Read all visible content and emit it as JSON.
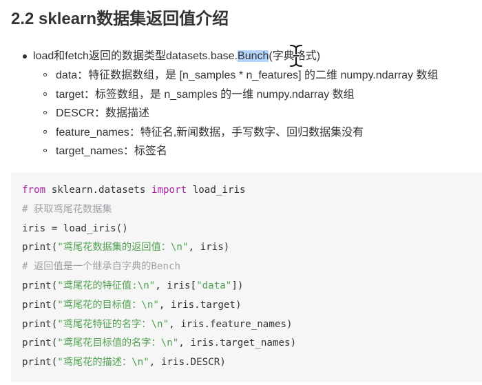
{
  "heading": "2.2 sklearn数据集返回值介绍",
  "bullet": {
    "prefix": "load和fetch返回的数据类型datasets.base.",
    "highlight": "Bunch",
    "suffix": "(字典格式)"
  },
  "sub_items": [
    "data：特征数据数组，是 [n_samples * n_features] 的二维 numpy.ndarray 数组",
    "target：标签数组，是 n_samples 的一维 numpy.ndarray 数组",
    "DESCR：数据描述",
    "feature_names：特征名,新闻数据，手写数字、回归数据集没有",
    "target_names：标签名"
  ],
  "code": {
    "line1": {
      "kw1": "from",
      "mid": " sklearn.datasets ",
      "kw2": "import",
      "rest": " load_iris"
    },
    "line2": "# 获取鸢尾花数据集",
    "line3": "iris = load_iris()",
    "line4": {
      "pre": "print(",
      "str": "\"鸢尾花数据集的返回值：\\n\"",
      "post": ", iris)"
    },
    "line5": "# 返回值是一个继承自字典的Bench",
    "line6": {
      "pre": "print(",
      "str": "\"鸢尾花的特征值:\\n\"",
      "mid": ", iris[",
      "str2": "\"data\"",
      "post": "])"
    },
    "line7": {
      "pre": "print(",
      "str": "\"鸢尾花的目标值：\\n\"",
      "post": ", iris.target)"
    },
    "line8": {
      "pre": "print(",
      "str": "\"鸢尾花特征的名字：\\n\"",
      "post": ", iris.feature_names)"
    },
    "line9": {
      "pre": "print(",
      "str": "\"鸢尾花目标值的名字：\\n\"",
      "post": ", iris.target_names)"
    },
    "line10": {
      "pre": "print(",
      "str": "\"鸢尾花的描述：\\n\"",
      "post": ", iris.DESCR)"
    }
  },
  "colors": {
    "keyword": "#a626a4",
    "string": "#50a14f",
    "comment": "#a0a1a7",
    "selection": "#b3d4fd",
    "code_bg": "#f6f6f6"
  },
  "icons": {
    "cursor": "text-cursor-ibeam-icon"
  }
}
